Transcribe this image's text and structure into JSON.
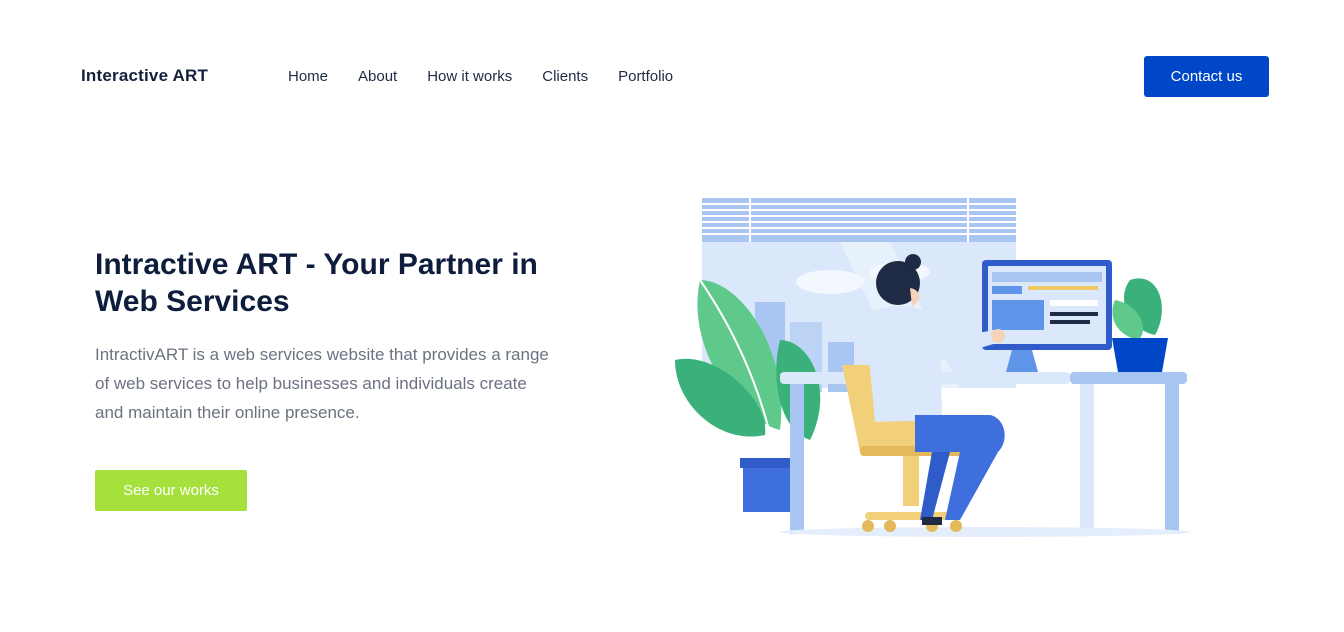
{
  "header": {
    "logo": "Interactive ART",
    "nav": [
      "Home",
      "About",
      "How it works",
      "Clients",
      "Portfolio"
    ],
    "contact_label": "Contact us"
  },
  "hero": {
    "title": "Intractive ART - Your Partner in Web Services",
    "description": "IntractivART is a web services website that provides a range of web services to help businesses and individuals create and maintain their online presence.",
    "cta_label": "See our works"
  },
  "colors": {
    "primary": "#0047c7",
    "accent_green": "#a6e03d",
    "heading": "#0f1d3d",
    "body_text": "#6b7280"
  }
}
